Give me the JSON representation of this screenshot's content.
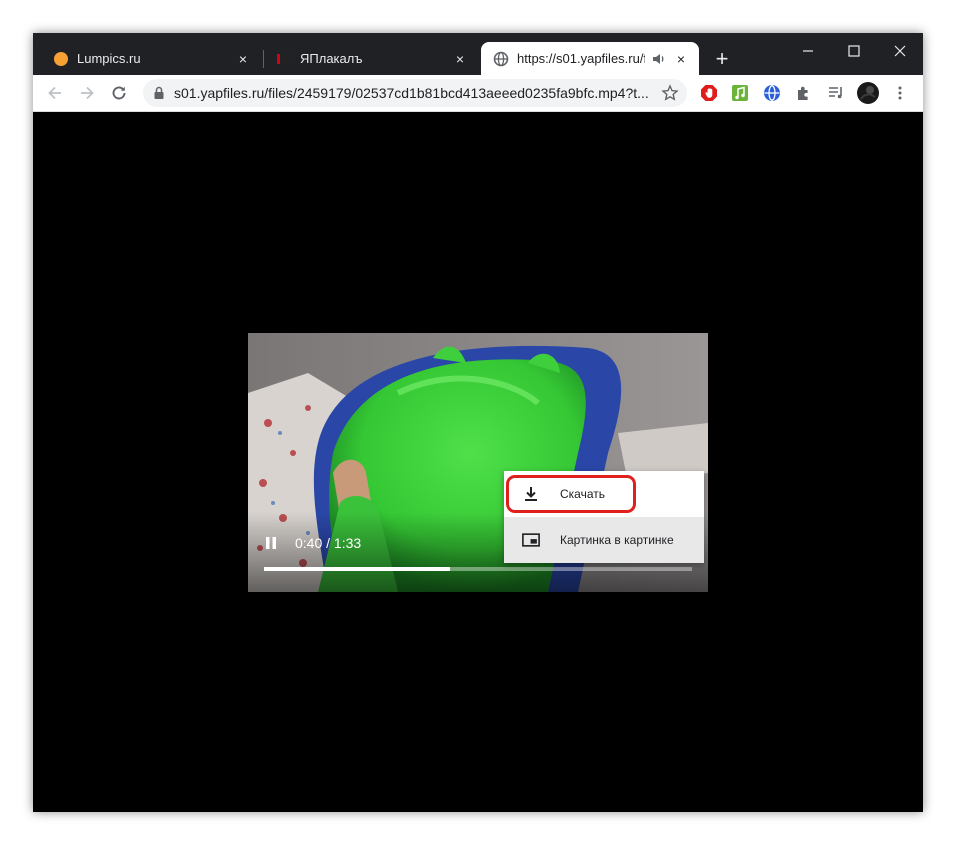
{
  "tabs": [
    {
      "title": "Lumpics.ru",
      "favicon": "orange-circle-icon",
      "close": "×"
    },
    {
      "title": "ЯПлакалъ",
      "favicon": "yaplakal-logo-icon",
      "close": "×"
    },
    {
      "title": "https://s01.yapfiles.ru/file",
      "favicon": "globe-icon",
      "close": "×",
      "audio_icon": "speaker-icon"
    }
  ],
  "new_tab": "+",
  "window_controls": {
    "minimize": "—",
    "maximize": "☐",
    "close": "✕"
  },
  "address_bar": {
    "url": "s01.yapfiles.ru/files/2459179/02537cd1b81bcd413aeeed0235fa9bfc.mp4?t..."
  },
  "video": {
    "time": "0:40 / 1:33",
    "progress": 0.435
  },
  "context_menu": {
    "items": [
      {
        "label": "Скачать",
        "icon": "download-icon"
      },
      {
        "label": "Картинка в картинке",
        "icon": "picture-in-picture-icon"
      }
    ]
  },
  "colors": {
    "titlebar": "#202124",
    "slime_green": "#3ec83e",
    "highlight": "#e0201c"
  }
}
